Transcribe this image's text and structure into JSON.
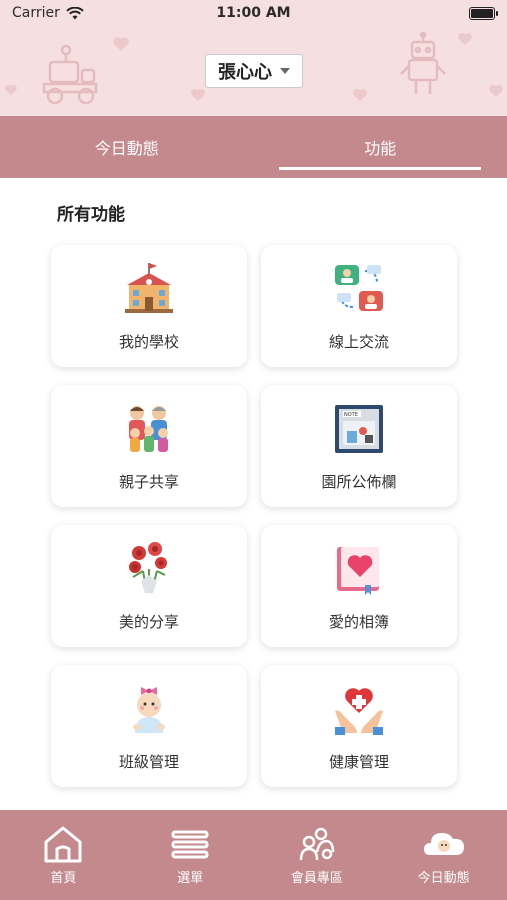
{
  "status_bar": {
    "carrier": "Carrier",
    "time": "11:00 AM"
  },
  "header": {
    "selected_child": "張心心"
  },
  "tabs": [
    {
      "label": "今日動態",
      "active": false
    },
    {
      "label": "功能",
      "active": true
    }
  ],
  "section_title": "所有功能",
  "features": [
    {
      "label": "我的學校",
      "icon": "school-icon"
    },
    {
      "label": "線上交流",
      "icon": "chat-icon"
    },
    {
      "label": "親子共享",
      "icon": "family-icon"
    },
    {
      "label": "園所公佈欄",
      "icon": "bulletin-board-icon"
    },
    {
      "label": "美的分享",
      "icon": "flowers-icon"
    },
    {
      "label": "愛的相簿",
      "icon": "heart-album-icon"
    },
    {
      "label": "班級管理",
      "icon": "baby-icon"
    },
    {
      "label": "健康管理",
      "icon": "health-hands-icon"
    }
  ],
  "bottom_nav": [
    {
      "label": "首頁",
      "icon": "home-icon"
    },
    {
      "label": "選單",
      "icon": "menu-icon"
    },
    {
      "label": "會員專區",
      "icon": "members-icon"
    },
    {
      "label": "今日動態",
      "icon": "cloud-baby-icon"
    }
  ],
  "colors": {
    "header_bg": "#f6dfe0",
    "accent": "#c3898c",
    "card_bg": "#ffffff"
  }
}
